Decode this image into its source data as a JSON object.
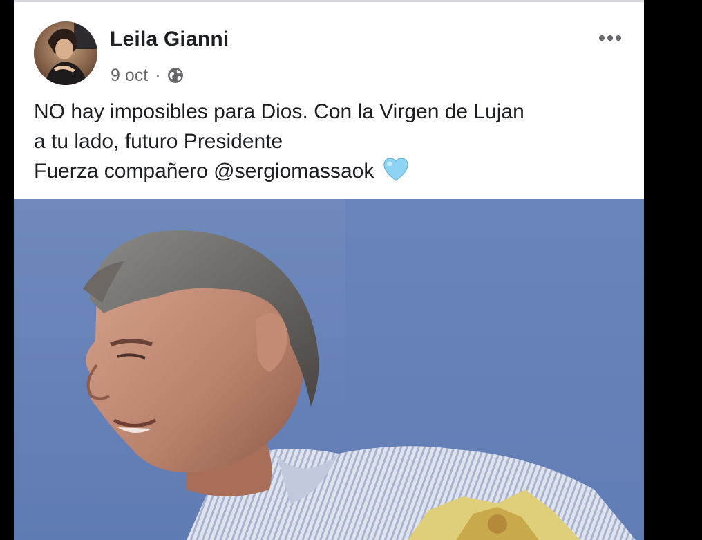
{
  "post": {
    "author_name": "Leila Gianni",
    "date": "9 oct",
    "separator": "·",
    "audience_icon": "globe-icon",
    "more_icon": "more-options-icon",
    "text_lines": [
      "NO hay imposibles para Dios. Con la Virgen de Lujan",
      "a tu lado, futuro Presidente"
    ],
    "text_line3_prefix": "Fuerza compañero ",
    "mention": "@sergiomassaok",
    "emoji_icon": "light-blue-heart-icon",
    "colors": {
      "text": "#1c1e21",
      "meta": "#65676b",
      "sky": "#6b85b8",
      "heart": "#8fd3f4"
    }
  }
}
